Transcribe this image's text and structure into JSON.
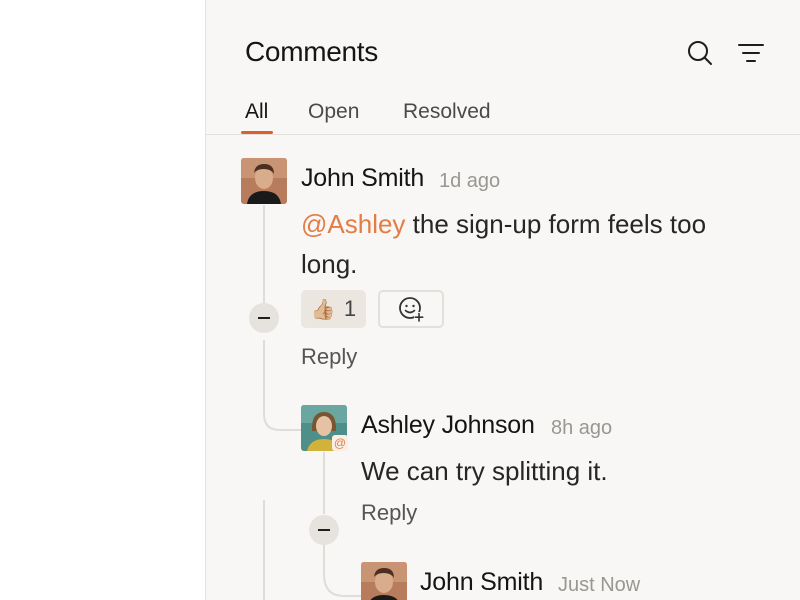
{
  "header": {
    "title": "Comments"
  },
  "tabs": [
    {
      "label": "All",
      "active": true
    },
    {
      "label": "Open",
      "active": false
    },
    {
      "label": "Resolved",
      "active": false
    }
  ],
  "comments": [
    {
      "author": "John Smith",
      "time": "1d ago",
      "mention": "@Ashley",
      "text": " the sign-up form feels too long.",
      "reactions": [
        {
          "emoji": "👍🏼",
          "count": "1"
        }
      ],
      "reply_label": "Reply"
    },
    {
      "author": "Ashley Johnson",
      "time": "8h ago",
      "text": "We can try splitting it.",
      "badge": "@",
      "reply_label": "Reply"
    },
    {
      "author": "John Smith",
      "time": "Just Now"
    }
  ],
  "colors": {
    "accent": "#d9622b",
    "mention": "#e27d45",
    "panel_bg": "#f8f7f5"
  },
  "icons": [
    "search-icon",
    "filter-icon",
    "add-reaction-icon",
    "collapse-icon"
  ]
}
